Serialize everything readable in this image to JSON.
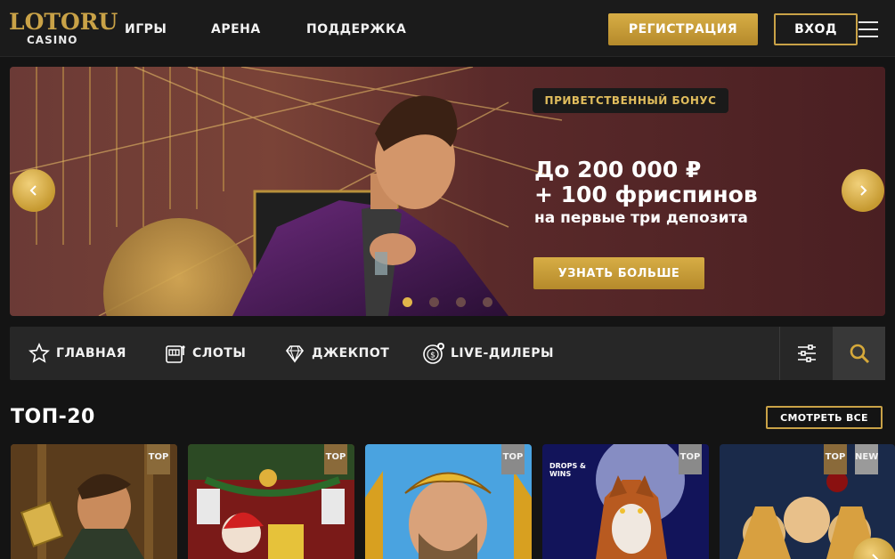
{
  "header": {
    "logo_text": "LOTORU",
    "logo_sub": "CASINO",
    "nav": [
      "ИГРЫ",
      "АРЕНА",
      "ПОДДЕРЖКА"
    ],
    "register_label": "РЕГИСТРАЦИЯ",
    "login_label": "ВХОД"
  },
  "banner": {
    "badge": "ПРИВЕТСТВЕННЫЙ БОНУС",
    "line1": "До 200 000 ₽",
    "line2": "+ 100 фриспинов",
    "line3": "на первые три депозита",
    "cta_label": "УЗНАТЬ БОЛЬШЕ",
    "slides_total": 4,
    "active_slide": 1
  },
  "categories": [
    {
      "label": "ГЛАВНАЯ",
      "icon": "star-icon"
    },
    {
      "label": "СЛОТЫ",
      "icon": "slot-machine-icon"
    },
    {
      "label": "ДЖЕКПОТ",
      "icon": "diamond-icon"
    },
    {
      "label": "LIVE-ДИЛЕРЫ",
      "icon": "chip-icon"
    }
  ],
  "section": {
    "title": "ТОП-20",
    "view_all_label": "СМОТРЕТЬ ВСЕ"
  },
  "games": [
    {
      "badge": "TOP",
      "badge2": "",
      "overlay": ""
    },
    {
      "badge": "TOP",
      "badge2": "",
      "overlay": ""
    },
    {
      "badge": "TOP",
      "badge2": "",
      "overlay": ""
    },
    {
      "badge": "TOP",
      "badge2": "",
      "overlay": "DROPS & WINS"
    },
    {
      "badge": "TOP",
      "badge2": "NEW",
      "overlay": ""
    }
  ],
  "colors": {
    "gold": "#c9a247",
    "background": "#141414",
    "header": "#1b1b1b",
    "category_bar": "#272727"
  }
}
